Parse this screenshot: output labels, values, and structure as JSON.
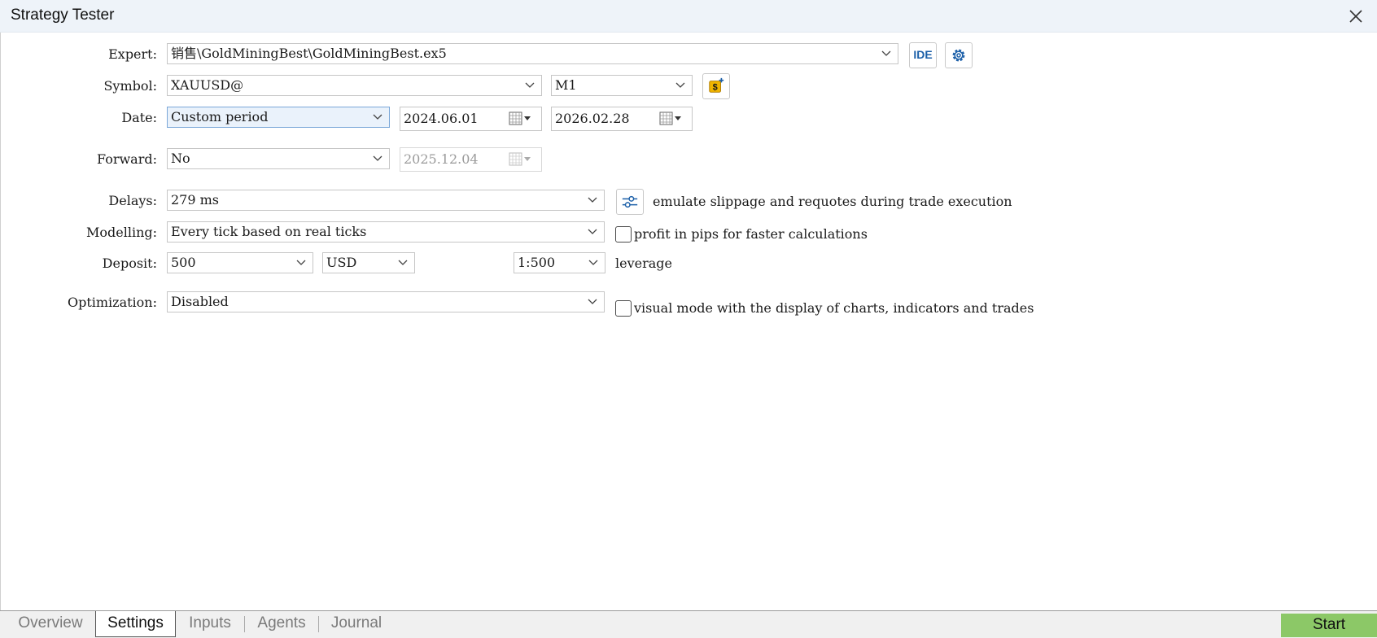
{
  "window": {
    "title": "Strategy Tester"
  },
  "labels": {
    "expert": "Expert:",
    "symbol": "Symbol:",
    "date": "Date:",
    "forward": "Forward:",
    "delays": "Delays:",
    "modelling": "Modelling:",
    "deposit": "Deposit:",
    "optimization": "Optimization:"
  },
  "fields": {
    "expert": "销售\\GoldMiningBest\\GoldMiningBest.ex5",
    "symbol": "XAUUSD@",
    "timeframe": "M1",
    "date_mode": "Custom period",
    "date_from": "2024.06.01",
    "date_to": "2026.02.28",
    "forward": "No",
    "forward_date": "2025.12.04",
    "delays": "279 ms",
    "modelling": "Every tick based on real ticks",
    "deposit": "500",
    "currency": "USD",
    "leverage": "1:500",
    "optimization": "Disabled"
  },
  "buttons": {
    "ide": "IDE"
  },
  "options": {
    "slippage_text": "emulate slippage and requotes during trade execution",
    "pips_text": "profit in pips for faster calculations",
    "pips_checked": false,
    "leverage_text": "leverage",
    "visual_text": "visual mode with the display of charts, indicators and trades",
    "visual_checked": false
  },
  "tabs": [
    {
      "label": "Overview",
      "active": false
    },
    {
      "label": "Settings",
      "active": true
    },
    {
      "label": "Inputs",
      "active": false
    },
    {
      "label": "Agents",
      "active": false
    },
    {
      "label": "Journal",
      "active": false
    }
  ],
  "start_label": "Start",
  "colors": {
    "accent": "#1b5fa8",
    "start": "#8cc867",
    "coin": "#f0b400"
  },
  "icons": [
    "close-icon",
    "ide-icon",
    "gear-icon",
    "coin-add-icon",
    "calendar-icon",
    "chevron-down-icon",
    "sliders-icon"
  ]
}
